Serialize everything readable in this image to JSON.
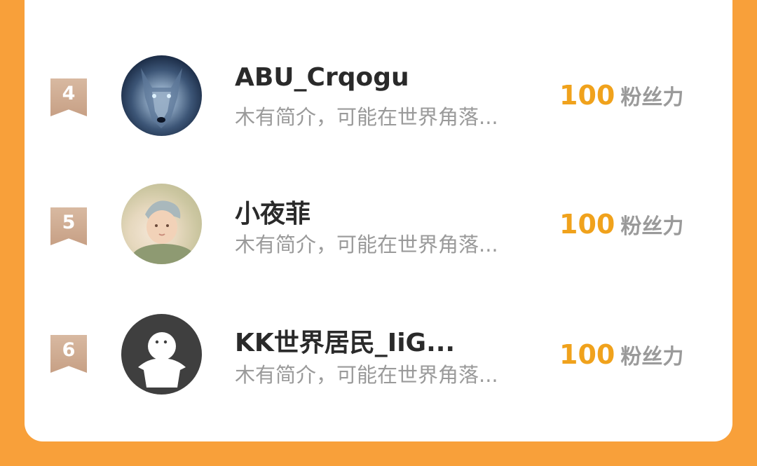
{
  "colors": {
    "background": "#F8A03A",
    "card": "#FFFFFF",
    "score": "#F0A21C",
    "rank_badge": "#C9A38A",
    "name": "#2A2A2A",
    "bio": "#9A9A9A"
  },
  "ranking": [
    {
      "rank": "4",
      "name": "ABU_Crqogu",
      "bio": "木有简介，可能在世界角落...",
      "score": "100",
      "score_label": "粉丝力",
      "avatar_icon": "wolf-avatar-icon"
    },
    {
      "rank": "5",
      "name": "小夜菲",
      "bio": "木有简介，可能在世界角落...",
      "score": "100",
      "score_label": "粉丝力",
      "avatar_icon": "baby-avatar-icon"
    },
    {
      "rank": "6",
      "name": "KK世界居民_IiG...",
      "bio": "木有简介，可能在世界角落...",
      "score": "100",
      "score_label": "粉丝力",
      "avatar_icon": "default-user-avatar-icon"
    }
  ]
}
